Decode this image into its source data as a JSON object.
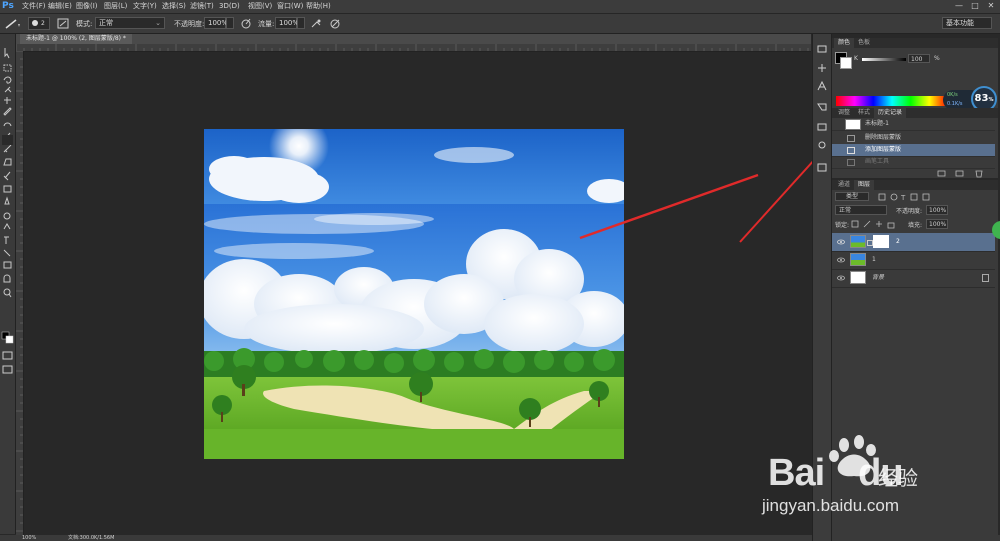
{
  "app": {
    "logo": "Ps"
  },
  "menu": {
    "items": [
      "文件(F)",
      "编辑(E)",
      "图像(I)",
      "图层(L)",
      "文字(Y)",
      "选择(S)",
      "滤镜(T)",
      "3D(D)",
      "视图(V)",
      "窗口(W)",
      "帮助(H)"
    ]
  },
  "window_controls": {
    "minimize": "—",
    "maximize": "□",
    "close": "✕"
  },
  "options": {
    "brush_size": "2",
    "mode_label": "模式:",
    "mode_value": "正常",
    "opacity_label": "不透明度:",
    "opacity_value": "100%",
    "flow_label": "流量:",
    "flow_value": "100%",
    "workspace": "基本功能"
  },
  "document": {
    "tab_title": "未标题-1 @ 100% (2, 图层蒙版/8) *"
  },
  "color_panel": {
    "tabs": [
      "颜色",
      "色板"
    ],
    "channel_label": "K",
    "channel_value": "100",
    "channel_unit": "%"
  },
  "overlay_widget": {
    "percent": "83",
    "unit": "%",
    "up": "0K/s",
    "down": "0.1K/s"
  },
  "history_panel": {
    "tabs": [
      "调整",
      "样式",
      "历史记录"
    ],
    "snapshot": "未标题-1",
    "items": [
      "删除图层蒙版",
      "添加图层蒙版",
      "画笔工具"
    ]
  },
  "layers_panel": {
    "tabs": [
      "通道",
      "图层"
    ],
    "kind_label": "类型",
    "blend_mode": "正常",
    "opacity_label": "不透明度:",
    "opacity_value": "100%",
    "lock_label": "锁定:",
    "fill_label": "填充:",
    "fill_value": "100%",
    "layers": [
      {
        "name": "2"
      },
      {
        "name": "1"
      },
      {
        "name": "背景"
      }
    ]
  },
  "watermark": {
    "brand": "Bai",
    "brand2": "du",
    "jingyan": "经验",
    "url": "jingyan.baidu.com"
  },
  "status": {
    "zoom": "100%",
    "doc_info": "文档:300.0K/1.56M"
  },
  "colors": {
    "accent": "#4ea5ff",
    "arrow": "#e02a2a",
    "sky": "#2f7fe0"
  }
}
